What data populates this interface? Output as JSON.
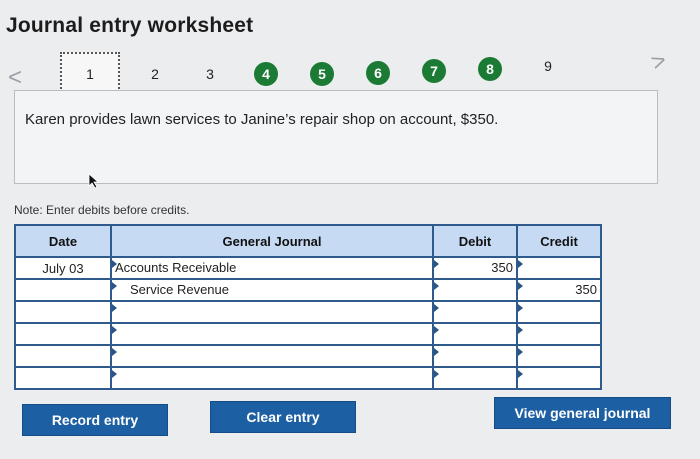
{
  "header": {
    "title": "Journal entry worksheet"
  },
  "nav": {
    "prev_icon": "chevron-left-icon",
    "next_icon": "chevron-right-icon",
    "prev_glyph": "<",
    "next_glyph": ">",
    "steps": [
      {
        "label": "1",
        "state": "current"
      },
      {
        "label": "2",
        "state": "plain"
      },
      {
        "label": "3",
        "state": "plain"
      },
      {
        "label": "4",
        "state": "done"
      },
      {
        "label": "5",
        "state": "done"
      },
      {
        "label": "6",
        "state": "done"
      },
      {
        "label": "7",
        "state": "done"
      },
      {
        "label": "8",
        "state": "done"
      },
      {
        "label": "9",
        "state": "plain"
      }
    ]
  },
  "prompt": {
    "text": "Karen provides lawn services to Janine’s repair shop on account, $350."
  },
  "note": "Note: Enter debits before credits.",
  "table": {
    "headers": {
      "date": "Date",
      "journal": "General Journal",
      "debit": "Debit",
      "credit": "Credit"
    },
    "rows": [
      {
        "date": "July 03",
        "account": "Accounts Receivable",
        "debit": "350",
        "credit": ""
      },
      {
        "date": "",
        "account": "Service Revenue",
        "debit": "",
        "credit": "350"
      },
      {
        "date": "",
        "account": "",
        "debit": "",
        "credit": ""
      },
      {
        "date": "",
        "account": "",
        "debit": "",
        "credit": ""
      },
      {
        "date": "",
        "account": "",
        "debit": "",
        "credit": ""
      },
      {
        "date": "",
        "account": "",
        "debit": "",
        "credit": ""
      }
    ]
  },
  "buttons": {
    "record": "Record entry",
    "clear": "Clear entry",
    "view": "View general journal"
  },
  "colors": {
    "header_bg": "#c6daf4",
    "border": "#2f5a8e",
    "button": "#1d5fa3",
    "step_done": "#1b7a33"
  }
}
